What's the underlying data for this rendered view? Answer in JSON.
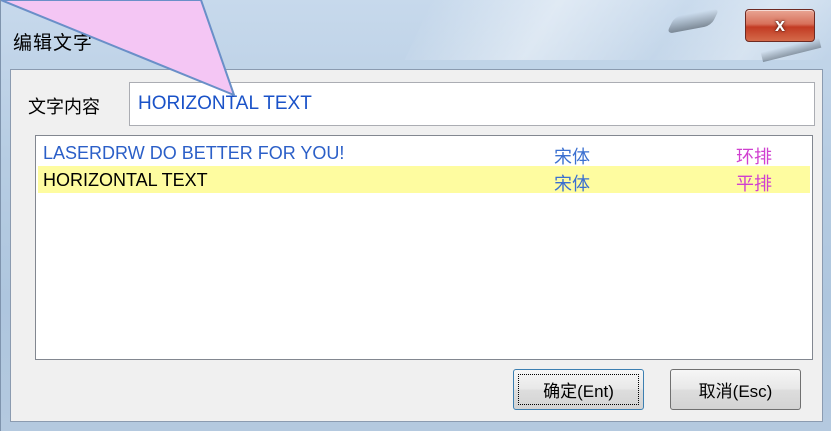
{
  "window": {
    "title": "编辑文字",
    "close_label": "x"
  },
  "text_field": {
    "label": "文字内容",
    "value": "HORIZONTAL TEXT"
  },
  "list": {
    "rows": [
      {
        "text": "LASERDRW DO BETTER FOR YOU!",
        "font": "宋体",
        "mode": "环排",
        "selected": false,
        "text_color": "#2b5fc8"
      },
      {
        "text": "HORIZONTAL TEXT",
        "font": "宋体",
        "mode": "平排",
        "selected": true,
        "text_color": "#000000"
      }
    ]
  },
  "buttons": {
    "ok": "确定(Ent)",
    "cancel": "取消(Esc)"
  },
  "colors": {
    "selected_row": "#fefca0",
    "font_column": "#3a6fd0",
    "mode_column": "#d040d0",
    "callout_fill": "#f4c6f4"
  }
}
